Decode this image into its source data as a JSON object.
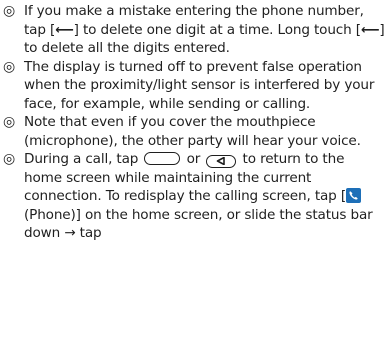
{
  "notes": [
    {
      "bullet": "◎",
      "seg1": "If you make a mistake entering the phone number, tap [",
      "icon_a": "⟵",
      "seg2": "] to delete one digit at a time. Long touch [",
      "icon_b": "⟵",
      "seg3": "] to delete all the digits entered."
    },
    {
      "bullet": "◎",
      "text": "The display is turned off to prevent false operation when the proximity/light sensor is interfered by your face, for example, while sending or calling."
    },
    {
      "bullet": "◎",
      "text": "Note that even if you cover the mouthpiece (microphone), the other party will hear your voice."
    },
    {
      "bullet": "◎",
      "seg1": "During a call, tap ",
      "seg2": " or ",
      "seg3": " to return to the home screen while maintaining the current connection. To redisplay the calling screen, tap [",
      "app_name": "(Phone)",
      "seg4": "] on the home screen, or slide the status bar down → tap",
      "home_key_icon": "home-key-icon",
      "back_key_icon": "back-key-icon",
      "phone_icon": "phone-app-icon"
    }
  ]
}
